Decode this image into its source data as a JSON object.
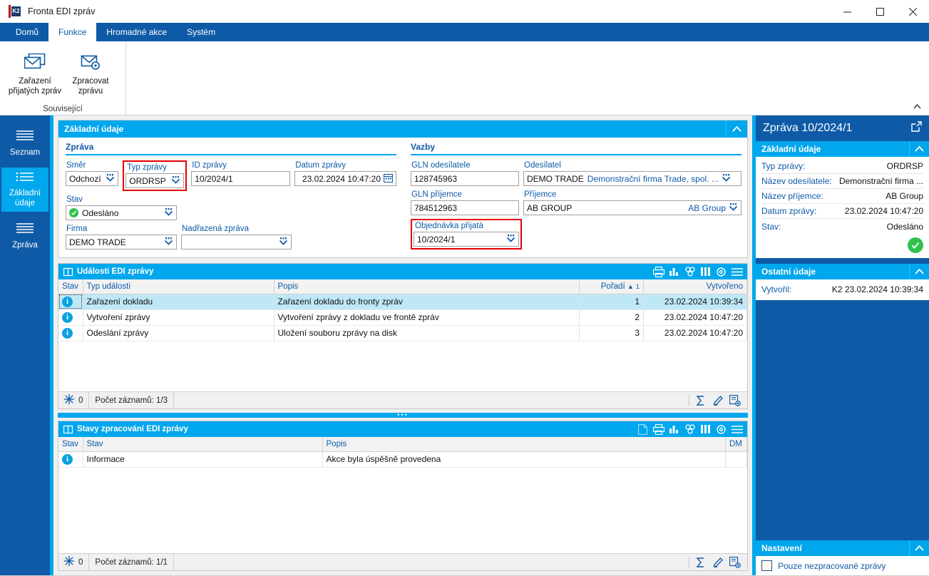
{
  "window": {
    "title": "Fronta EDI zpráv",
    "icon": "k2-app-icon",
    "minimize": "–",
    "maximize": "▢",
    "close": "✕"
  },
  "ribbon": {
    "tabs": [
      {
        "label": "Domů",
        "active": false
      },
      {
        "label": "Funkce",
        "active": true
      },
      {
        "label": "Hromadné akce",
        "active": false
      },
      {
        "label": "Systém",
        "active": false
      }
    ],
    "groups": [
      {
        "title": "Související",
        "buttons": [
          {
            "label_line1": "Zařazení",
            "label_line2": "přijatých zpráv",
            "icon": "mail-envelope-icon"
          },
          {
            "label_line1": "Zpracovat",
            "label_line2": "zprávu",
            "icon": "mail-gear-icon"
          }
        ]
      }
    ]
  },
  "leftnav": {
    "items": [
      {
        "label": "Seznam",
        "icon": "list-lines-icon",
        "active": false
      },
      {
        "label_line1": "Základní",
        "label_line2": "údaje",
        "icon": "bullet-list-icon",
        "active": true
      },
      {
        "label": "Zpráva",
        "icon": "list-lines-icon",
        "active": false
      }
    ]
  },
  "basic_card": {
    "title": "Základní údaje",
    "collapse_icon": "chevron-up-icon",
    "message_section": {
      "title": "Zpráva",
      "fields": {
        "smer": {
          "label": "Směr",
          "value": "Odchozí"
        },
        "typ_zpravy": {
          "label": "Typ zprávy",
          "value": "ORDRSP",
          "highlighted": true
        },
        "id_zpravy": {
          "label": "ID zprávy",
          "value": "10/2024/1"
        },
        "datum_zpravy": {
          "label": "Datum zprávy",
          "value": "23.02.2024 10:47:20"
        },
        "stav": {
          "label": "Stav",
          "value": "Odesláno"
        },
        "firma": {
          "label": "Firma",
          "value": "DEMO TRADE"
        },
        "nadrazena_zprava": {
          "label": "Nadřazená zpráva",
          "value": ""
        }
      }
    },
    "links_section": {
      "title": "Vazby",
      "fields": {
        "gln_odesilatele": {
          "label": "GLN odesílatele",
          "value": "128745963"
        },
        "odesilatel": {
          "label": "Odesílatel",
          "value": "DEMO TRADE",
          "sub": "Demonstrační firma Trade, spol. ..."
        },
        "gln_prijemce": {
          "label": "GLN příjemce",
          "value": "784512963"
        },
        "prijemce": {
          "label": "Příjemce",
          "value": "AB GROUP",
          "sub": "AB Group"
        },
        "objednavka_prijata": {
          "label": "Objednávka přijatá",
          "value": "10/2024/1",
          "highlighted": true
        }
      }
    }
  },
  "events_table": {
    "title": "Události EDI zprávy",
    "title_icon": "book-icon",
    "tools": [
      "print-icon",
      "chart-icon",
      "pivot-icon",
      "columns-icon",
      "settings-gear-icon",
      "hamburger-menu-icon"
    ],
    "columns": [
      {
        "label": "Stav",
        "align": "left"
      },
      {
        "label": "Typ události",
        "align": "left"
      },
      {
        "label": "Popis",
        "align": "left"
      },
      {
        "label": "Pořadí",
        "align": "right",
        "sort": "▲",
        "sort_index": "1"
      },
      {
        "label": "Vytvořeno",
        "align": "right"
      }
    ],
    "rows": [
      {
        "status": "i",
        "typ": "Zařazení dokladu",
        "popis": "Zařazení dokladu do fronty zpráv",
        "poradi": "1",
        "vytvoreno": "23.02.2024 10:39:34",
        "selected": true
      },
      {
        "status": "i",
        "typ": "Vytvoření zprávy",
        "popis": "Vytvoření zprávy z dokladu ve frontě zpráv",
        "poradi": "2",
        "vytvoreno": "23.02.2024 10:47:20",
        "selected": false
      },
      {
        "status": "i",
        "typ": "Odeslání zprávy",
        "popis": "Uložení souboru zprávy na disk",
        "poradi": "3",
        "vytvoreno": "23.02.2024 10:47:20",
        "selected": false
      }
    ],
    "footer": {
      "filter_icon": "filter-snowflake-icon",
      "filter_count": "0",
      "record_count": "Počet záznamů: 1/3",
      "tools": [
        "sum-sigma-icon",
        "edit-pencil-icon",
        "new-record-icon"
      ]
    }
  },
  "states_table": {
    "title": "Stavy zpracování EDI zprávy",
    "title_icon": "book-icon",
    "tools": [
      "document-icon",
      "print-icon",
      "chart-icon",
      "pivot-icon",
      "columns-icon",
      "settings-gear-icon",
      "hamburger-menu-icon"
    ],
    "columns": [
      {
        "label": "Stav",
        "align": "left"
      },
      {
        "label": "Stav",
        "align": "left"
      },
      {
        "label": "Popis",
        "align": "left"
      },
      {
        "label": "DM",
        "align": "left"
      }
    ],
    "rows": [
      {
        "status": "i",
        "stav": "Informace",
        "popis": "Akce byla úspěšně provedena",
        "dm": ""
      }
    ],
    "footer": {
      "filter_icon": "filter-snowflake-icon",
      "filter_count": "0",
      "record_count": "Počet záznamů: 1/1",
      "tools": [
        "sum-sigma-icon",
        "edit-pencil-icon",
        "new-record-icon"
      ]
    }
  },
  "right_panel": {
    "title": "Zpráva 10/2024/1",
    "popout_icon": "popout-icon",
    "sections": [
      {
        "title": "Základní údaje",
        "collapse_icon": "chevron-up-icon",
        "rows": [
          {
            "key": "Typ zprávy:",
            "value": "ORDRSP"
          },
          {
            "key": "Název odesílatele:",
            "value": "Demonstrační firma ..."
          },
          {
            "key": "Název příjemce:",
            "value": "AB Group"
          },
          {
            "key": "Datum zprávy:",
            "value": "23.02.2024 10:47:20"
          },
          {
            "key": "Stav:",
            "value": "Odesláno"
          }
        ],
        "status_icon": "green-check-icon"
      },
      {
        "title": "Ostatní údaje",
        "collapse_icon": "chevron-up-icon",
        "rows": [
          {
            "key": "Vytvořil:",
            "value": "K2 23.02.2024 10:39:34"
          }
        ]
      }
    ],
    "settings": {
      "title": "Nastavení",
      "collapse_icon": "chevron-up-icon",
      "checkbox": {
        "label": "Pouze nezpracované zprávy",
        "checked": false
      }
    }
  },
  "colors": {
    "brand_dark_blue": "#0e5aa7",
    "brand_cyan": "#00a7ec",
    "highlight_red": "#e60000",
    "status_green": "#2fc14c",
    "row_selected": "#bfe8f7"
  }
}
